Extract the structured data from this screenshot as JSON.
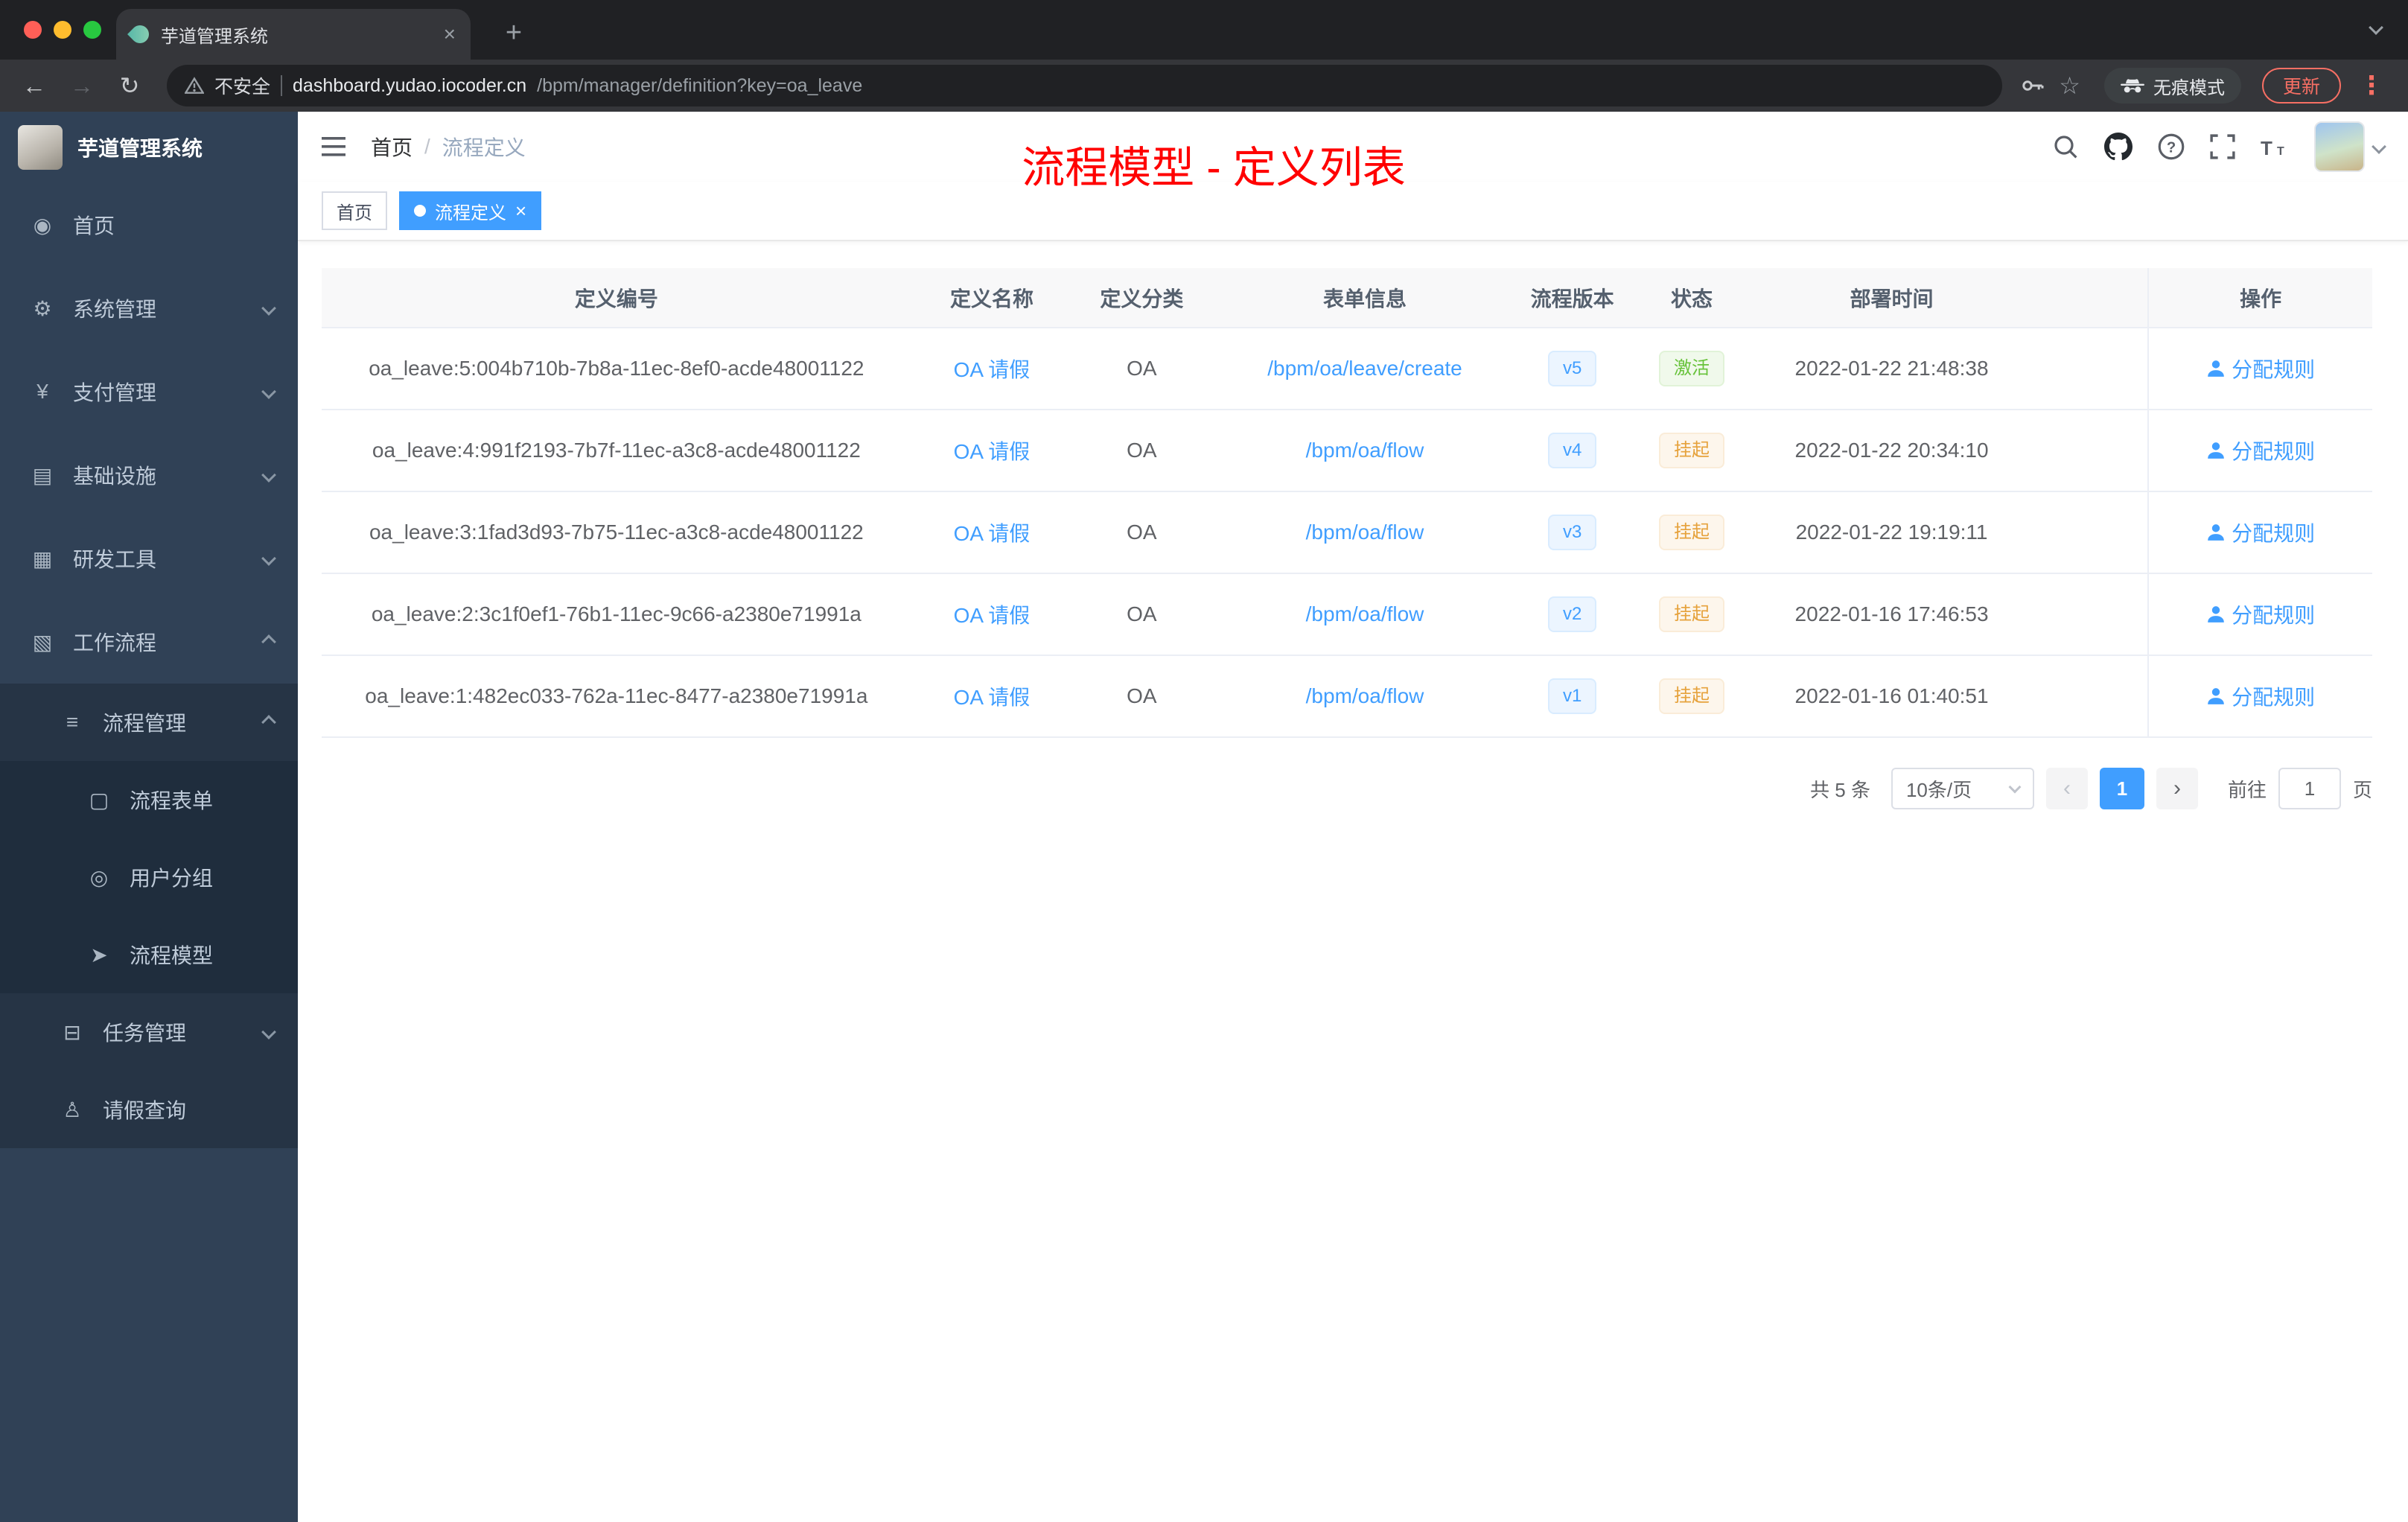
{
  "browser": {
    "tab_title": "芋道管理系统",
    "security_label": "不安全",
    "url_host": "dashboard.yudao.iocoder.cn",
    "url_path": "/bpm/manager/definition?key=oa_leave",
    "incognito_label": "无痕模式",
    "update_label": "更新"
  },
  "sidebar": {
    "logo_title": "芋道管理系统",
    "items": [
      {
        "label": "首页",
        "level": 1,
        "icon": "home-icon",
        "expand": null
      },
      {
        "label": "系统管理",
        "level": 1,
        "icon": "gear-icon",
        "expand": "down"
      },
      {
        "label": "支付管理",
        "level": 1,
        "icon": "payment-icon",
        "expand": "down"
      },
      {
        "label": "基础设施",
        "level": 1,
        "icon": "infrastructure-icon",
        "expand": "down"
      },
      {
        "label": "研发工具",
        "level": 1,
        "icon": "dev-tools-icon",
        "expand": "down"
      },
      {
        "label": "工作流程",
        "level": 1,
        "icon": "workflow-icon",
        "expand": "up"
      },
      {
        "label": "流程管理",
        "level": 2,
        "icon": "process-management-icon",
        "expand": "up"
      },
      {
        "label": "流程表单",
        "level": 3,
        "icon": "process-form-icon",
        "expand": null
      },
      {
        "label": "用户分组",
        "level": 3,
        "icon": "user-group-icon",
        "expand": null
      },
      {
        "label": "流程模型",
        "level": 3,
        "icon": "process-model-icon",
        "expand": null
      },
      {
        "label": "任务管理",
        "level": 2,
        "icon": "task-management-icon",
        "expand": "down"
      },
      {
        "label": "请假查询",
        "level": 2,
        "icon": "leave-query-icon",
        "expand": null
      }
    ]
  },
  "header": {
    "breadcrumb_home": "首页",
    "breadcrumb_separator": "/",
    "breadcrumb_current": "流程定义",
    "page_title": "流程模型 - 定义列表"
  },
  "tags": [
    {
      "label": "首页",
      "active": false
    },
    {
      "label": "流程定义",
      "active": true
    }
  ],
  "table": {
    "columns": [
      "定义编号",
      "定义名称",
      "定义分类",
      "表单信息",
      "流程版本",
      "状态",
      "部署时间",
      "操作"
    ],
    "rows": [
      {
        "id": "oa_leave:5:004b710b-7b8a-11ec-8ef0-acde48001122",
        "name": "OA 请假",
        "category": "OA",
        "form": "/bpm/oa/leave/create",
        "version": "v5",
        "status": "激活",
        "status_type": "success",
        "deploy_time": "2022-01-22 21:48:38",
        "action": "分配规则"
      },
      {
        "id": "oa_leave:4:991f2193-7b7f-11ec-a3c8-acde48001122",
        "name": "OA 请假",
        "category": "OA",
        "form": "/bpm/oa/flow",
        "version": "v4",
        "status": "挂起",
        "status_type": "warning",
        "deploy_time": "2022-01-22 20:34:10",
        "action": "分配规则"
      },
      {
        "id": "oa_leave:3:1fad3d93-7b75-11ec-a3c8-acde48001122",
        "name": "OA 请假",
        "category": "OA",
        "form": "/bpm/oa/flow",
        "version": "v3",
        "status": "挂起",
        "status_type": "warning",
        "deploy_time": "2022-01-22 19:19:11",
        "action": "分配规则"
      },
      {
        "id": "oa_leave:2:3c1f0ef1-76b1-11ec-9c66-a2380e71991a",
        "name": "OA 请假",
        "category": "OA",
        "form": "/bpm/oa/flow",
        "version": "v2",
        "status": "挂起",
        "status_type": "warning",
        "deploy_time": "2022-01-16 17:46:53",
        "action": "分配规则"
      },
      {
        "id": "oa_leave:1:482ec033-762a-11ec-8477-a2380e71991a",
        "name": "OA 请假",
        "category": "OA",
        "form": "/bpm/oa/flow",
        "version": "v1",
        "status": "挂起",
        "status_type": "warning",
        "deploy_time": "2022-01-16 01:40:51",
        "action": "分配规则"
      }
    ]
  },
  "pagination": {
    "total": "共 5 条",
    "page_size": "10条/页",
    "prev": "‹",
    "page": "1",
    "next": "›",
    "goto": "前往",
    "goto_value": "1",
    "unit": "页"
  }
}
